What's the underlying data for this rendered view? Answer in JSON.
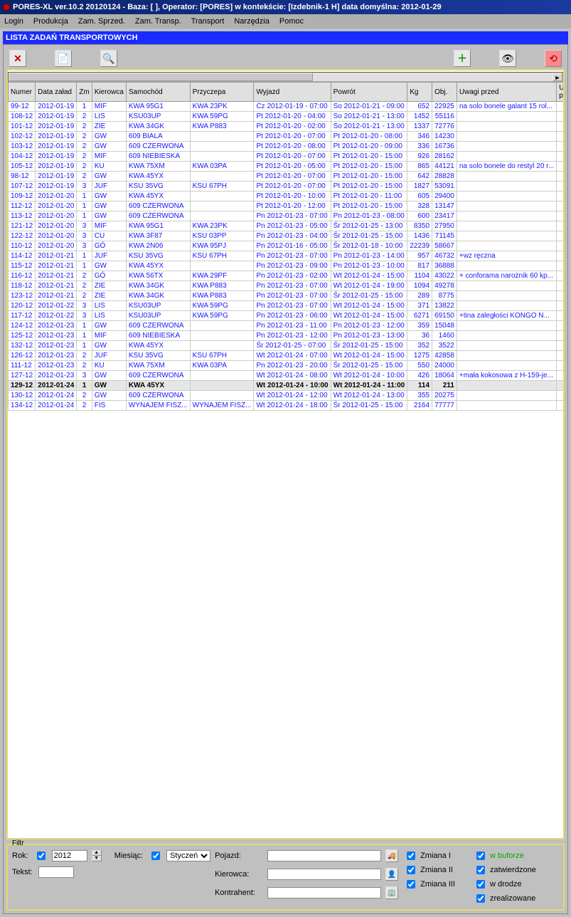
{
  "title": "PORES-XL ver.10.2  20120124 - Baza: [        ], Operator: [PORES]  w kontekście: [Izdebnik-1 H] data domyślna: 2012-01-29",
  "menu": {
    "items": [
      "Login",
      "Produkcja",
      "Zam. Sprzed.",
      "Zam. Transp.",
      "Transport",
      "Narzędzia",
      "Pomoc"
    ]
  },
  "caption": "LISTA ZADAŃ TRANSPORTOWYCH",
  "columns": [
    "Numer",
    "Data załad",
    "Zm",
    "Kierowca",
    "Samochód",
    "Przyczepa",
    "Wyjazd",
    "Powrót",
    "Kg",
    "Obj.",
    "Uwagi przed",
    "Uwagi po"
  ],
  "rows": [
    {
      "num": "99-12",
      "data": "2012-01-19",
      "zm": "1",
      "kier": "MIF",
      "sam": "KWA 95G1",
      "przy": "KWA 23PK",
      "wyj": "Cz 2012-01-19  -  07:00",
      "pow": "So 2012-01-21  -  09:00",
      "kg": "652",
      "obj": "22925",
      "uprzed": "na solo bonele galant 15 rol...",
      "upo": "",
      "sel": false
    },
    {
      "num": "108-12",
      "data": "2012-01-19",
      "zm": "2",
      "kier": "LIS",
      "sam": "KSU03UP",
      "przy": "KWA 59PG",
      "wyj": "Pt 2012-01-20  -  04:00",
      "pow": "So 2012-01-21  -  13:00",
      "kg": "1452",
      "obj": "55116",
      "uprzed": "",
      "upo": ""
    },
    {
      "num": "101-12",
      "data": "2012-01-19",
      "zm": "2",
      "kier": "ZIE",
      "sam": "KWA 34GK",
      "przy": "KWA P883",
      "wyj": "Pt 2012-01-20  -  02:00",
      "pow": "So 2012-01-21  -  13:00",
      "kg": "1337",
      "obj": "72776",
      "uprzed": "",
      "upo": ""
    },
    {
      "num": "102-12",
      "data": "2012-01-19",
      "zm": "2",
      "kier": "GW",
      "sam": "609 BIALA",
      "przy": "",
      "wyj": "Pt 2012-01-20  -  07:00",
      "pow": "Pt 2012-01-20  -  08:00",
      "kg": "346",
      "obj": "14230",
      "uprzed": "",
      "upo": ""
    },
    {
      "num": "103-12",
      "data": "2012-01-19",
      "zm": "2",
      "kier": "GW",
      "sam": "609 CZERWONA",
      "przy": "",
      "wyj": "Pt 2012-01-20  -  08:00",
      "pow": "Pt 2012-01-20  -  09:00",
      "kg": "336",
      "obj": "16736",
      "uprzed": "",
      "upo": ""
    },
    {
      "num": "104-12",
      "data": "2012-01-19",
      "zm": "2",
      "kier": "MIF",
      "sam": "609 NIEBIESKA",
      "przy": "",
      "wyj": "Pt 2012-01-20  -  07:00",
      "pow": "Pt 2012-01-20  -  15:00",
      "kg": "926",
      "obj": "28162",
      "uprzed": "",
      "upo": ""
    },
    {
      "num": "105-12",
      "data": "2012-01-19",
      "zm": "2",
      "kier": "KU",
      "sam": "KWA 75XM",
      "przy": "KWA 03PA",
      "wyj": "Pt 2012-01-20  -  05:00",
      "pow": "Pt 2012-01-20  -  15:00",
      "kg": "865",
      "obj": "44121",
      "uprzed": "na solo bonele do restyl 20 r...",
      "upo": ""
    },
    {
      "num": "98-12",
      "data": "2012-01-19",
      "zm": "2",
      "kier": "GW",
      "sam": "KWA 45YX",
      "przy": "",
      "wyj": "Pt 2012-01-20  -  07:00",
      "pow": "Pt 2012-01-20  -  15:00",
      "kg": "642",
      "obj": "28828",
      "uprzed": "",
      "upo": ""
    },
    {
      "num": "107-12",
      "data": "2012-01-19",
      "zm": "3",
      "kier": "JUF",
      "sam": "KSU 35VG",
      "przy": "KSU 67PH",
      "wyj": "Pt 2012-01-20  -  07:00",
      "pow": "Pt 2012-01-20  -  15:00",
      "kg": "1827",
      "obj": "53091",
      "uprzed": "",
      "upo": ""
    },
    {
      "num": "109-12",
      "data": "2012-01-20",
      "zm": "1",
      "kier": "GW",
      "sam": "KWA 45YX",
      "przy": "",
      "wyj": "Pt 2012-01-20  -  10:00",
      "pow": "Pt 2012-01-20  -  11:00",
      "kg": "605",
      "obj": "29400",
      "uprzed": "",
      "upo": ""
    },
    {
      "num": "112-12",
      "data": "2012-01-20",
      "zm": "1",
      "kier": "GW",
      "sam": "609 CZERWONA",
      "przy": "",
      "wyj": "Pt 2012-01-20  -  12:00",
      "pow": "Pt 2012-01-20  -  15:00",
      "kg": "328",
      "obj": "13147",
      "uprzed": "",
      "upo": ""
    },
    {
      "num": "113-12",
      "data": "2012-01-20",
      "zm": "1",
      "kier": "GW",
      "sam": "609 CZERWONA",
      "przy": "",
      "wyj": "Pn 2012-01-23  -  07:00",
      "pow": "Pn 2012-01-23  -  08:00",
      "kg": "600",
      "obj": "23417",
      "uprzed": "",
      "upo": ""
    },
    {
      "num": "121-12",
      "data": "2012-01-20",
      "zm": "3",
      "kier": "MIF",
      "sam": "KWA 95G1",
      "przy": "KWA 23PK",
      "wyj": "Pn 2012-01-23  -  05:00",
      "pow": "Śr 2012-01-25  -  13:00",
      "kg": "8350",
      "obj": "27950",
      "uprzed": "",
      "upo": ""
    },
    {
      "num": "122-12",
      "data": "2012-01-20",
      "zm": "3",
      "kier": "CU",
      "sam": "KWA 3F87",
      "przy": "KSU 03PP",
      "wyj": "Pn 2012-01-23  -  04:00",
      "pow": "Śr 2012-01-25  -  15:00",
      "kg": "1436",
      "obj": "71145",
      "uprzed": "",
      "upo": ""
    },
    {
      "num": "110-12",
      "data": "2012-01-20",
      "zm": "3",
      "kier": "GÓ",
      "sam": "KWA 2N06",
      "przy": "KWA 95PJ",
      "wyj": "Pn 2012-01-16  -  05:00",
      "pow": "Śr 2012-01-18  -  10:00",
      "kg": "22239",
      "obj": "58667",
      "uprzed": "",
      "upo": ""
    },
    {
      "num": "114-12",
      "data": "2012-01-21",
      "zm": "1",
      "kier": "JUF",
      "sam": "KSU 35VG",
      "przy": "KSU 67PH",
      "wyj": "Pn 2012-01-23  -  07:00",
      "pow": "Pn 2012-01-23  -  14:00",
      "kg": "957",
      "obj": "46732",
      "uprzed": "+wz ręczna",
      "upo": ""
    },
    {
      "num": "115-12",
      "data": "2012-01-21",
      "zm": "1",
      "kier": "GW",
      "sam": "KWA 45YX",
      "przy": "",
      "wyj": "Pn 2012-01-23  -  09:00",
      "pow": "Pn 2012-01-23  -  10:00",
      "kg": "817",
      "obj": "36888",
      "uprzed": "",
      "upo": ""
    },
    {
      "num": "116-12",
      "data": "2012-01-21",
      "zm": "2",
      "kier": "GÓ",
      "sam": "KWA 56TX",
      "przy": "KWA 29PF",
      "wyj": "Pn 2012-01-23  -  02:00",
      "pow": "Wt 2012-01-24  -  15:00",
      "kg": "1104",
      "obj": "43022",
      "uprzed": "+ conforama narożnik 60 kp...",
      "upo": ""
    },
    {
      "num": "118-12",
      "data": "2012-01-21",
      "zm": "2",
      "kier": "ZIE",
      "sam": "KWA 34GK",
      "przy": "KWA P883",
      "wyj": "Pn 2012-01-23  -  07:00",
      "pow": "Wt 2012-01-24  -  19:00",
      "kg": "1094",
      "obj": "49278",
      "uprzed": "",
      "upo": ""
    },
    {
      "num": "123-12",
      "data": "2012-01-21",
      "zm": "2",
      "kier": "ZIE",
      "sam": "KWA 34GK",
      "przy": "KWA P883",
      "wyj": "Pn 2012-01-23  -  07:00",
      "pow": "Śr 2012-01-25  -  15:00",
      "kg": "289",
      "obj": "8775",
      "uprzed": "",
      "upo": ""
    },
    {
      "num": "120-12",
      "data": "2012-01-22",
      "zm": "3",
      "kier": "LIS",
      "sam": "KSU03UP",
      "przy": "KWA 59PG",
      "wyj": "Pn 2012-01-23  -  07:00",
      "pow": "Wt 2012-01-24  -  15:00",
      "kg": "371",
      "obj": "13822",
      "uprzed": "",
      "upo": ""
    },
    {
      "num": "117-12",
      "data": "2012-01-22",
      "zm": "3",
      "kier": "LIS",
      "sam": "KSU03UP",
      "przy": "KWA 59PG",
      "wyj": "Pn 2012-01-23  -  06:00",
      "pow": "Wt 2012-01-24  -  15:00",
      "kg": "6271",
      "obj": "69150",
      "uprzed": "+tina zaległości KONGO N...",
      "upo": ""
    },
    {
      "num": "124-12",
      "data": "2012-01-23",
      "zm": "1",
      "kier": "GW",
      "sam": "609 CZERWONA",
      "przy": "",
      "wyj": "Pn 2012-01-23  -  11:00",
      "pow": "Pn 2012-01-23  -  12:00",
      "kg": "359",
      "obj": "15048",
      "uprzed": "",
      "upo": ""
    },
    {
      "num": "125-12",
      "data": "2012-01-23",
      "zm": "1",
      "kier": "MIF",
      "sam": "609 NIEBIESKA",
      "przy": "",
      "wyj": "Pn 2012-01-23  -  12:00",
      "pow": "Pn 2012-01-23  -  13:00",
      "kg": "36",
      "obj": "1460",
      "uprzed": "",
      "upo": ""
    },
    {
      "num": "132-12",
      "data": "2012-01-23",
      "zm": "1",
      "kier": "GW",
      "sam": "KWA 45YX",
      "przy": "",
      "wyj": "Śr 2012-01-25  -  07:00",
      "pow": "Śr 2012-01-25  -  15:00",
      "kg": "352",
      "obj": "3522",
      "uprzed": "",
      "upo": ""
    },
    {
      "num": "126-12",
      "data": "2012-01-23",
      "zm": "2",
      "kier": "JUF",
      "sam": "KSU 35VG",
      "przy": "KSU 67PH",
      "wyj": "Wt 2012-01-24  -  07:00",
      "pow": "Wt 2012-01-24  -  15:00",
      "kg": "1275",
      "obj": "42858",
      "uprzed": "",
      "upo": ""
    },
    {
      "num": "111-12",
      "data": "2012-01-23",
      "zm": "2",
      "kier": "KU",
      "sam": "KWA 75XM",
      "przy": "KWA 03PA",
      "wyj": "Pn 2012-01-23  -  20:00",
      "pow": "Śr 2012-01-25  -  15:00",
      "kg": "550",
      "obj": "24000",
      "uprzed": "",
      "upo": ""
    },
    {
      "num": "127-12",
      "data": "2012-01-23",
      "zm": "3",
      "kier": "GW",
      "sam": "609 CZERWONA",
      "przy": "",
      "wyj": "Wt 2012-01-24  -  08:00",
      "pow": "Wt 2012-01-24  -  10:00",
      "kg": "426",
      "obj": "18064",
      "uprzed": "+mała kokosowa z H-159-je...",
      "upo": ""
    },
    {
      "num": "129-12",
      "data": "2012-01-24",
      "zm": "1",
      "kier": "GW",
      "sam": "KWA 45YX",
      "przy": "",
      "wyj": "Wt 2012-01-24  -  10:00",
      "pow": "Wt 2012-01-24  -  11:00",
      "kg": "114",
      "obj": "211",
      "uprzed": "",
      "upo": "",
      "sel": true
    },
    {
      "num": "130-12",
      "data": "2012-01-24",
      "zm": "2",
      "kier": "GW",
      "sam": "609 CZERWONA",
      "przy": "",
      "wyj": "Wt 2012-01-24  -  12:00",
      "pow": "Wt 2012-01-24  -  13:00",
      "kg": "355",
      "obj": "20275",
      "uprzed": "",
      "upo": ""
    },
    {
      "num": "134-12",
      "data": "2012-01-24",
      "zm": "2",
      "kier": "FIS",
      "sam": "WYNAJEM FISZ...",
      "przy": "WYNAJEM FISZ...",
      "wyj": "Wt 2012-01-24  -  18:00",
      "pow": "Śr 2012-01-25  -  15:00",
      "kg": "2164",
      "obj": "77777",
      "uprzed": "",
      "upo": ""
    }
  ],
  "filter": {
    "title": "Filtr",
    "rok_label": "Rok:",
    "rok_value": "2012",
    "mies_label": "Miesiąc:",
    "mies_value": "Styczeń",
    "tekst_label": "Tekst:",
    "tekst_value": "",
    "pojazd_label": "Pojazd:",
    "pojazd_value": "",
    "kierowca_label": "Kierowca:",
    "kierowca_value": "",
    "kontrahent_label": "Kontrahent:",
    "kontrahent_value": "",
    "zmiana1": "Zmiana I",
    "zmiana2": "Zmiana II",
    "zmiana3": "Zmiana III",
    "wbuforze": "w buforze",
    "zatw": "zatwierdzone",
    "wdrodze": "w drodze",
    "zreal": "zrealizowane"
  }
}
